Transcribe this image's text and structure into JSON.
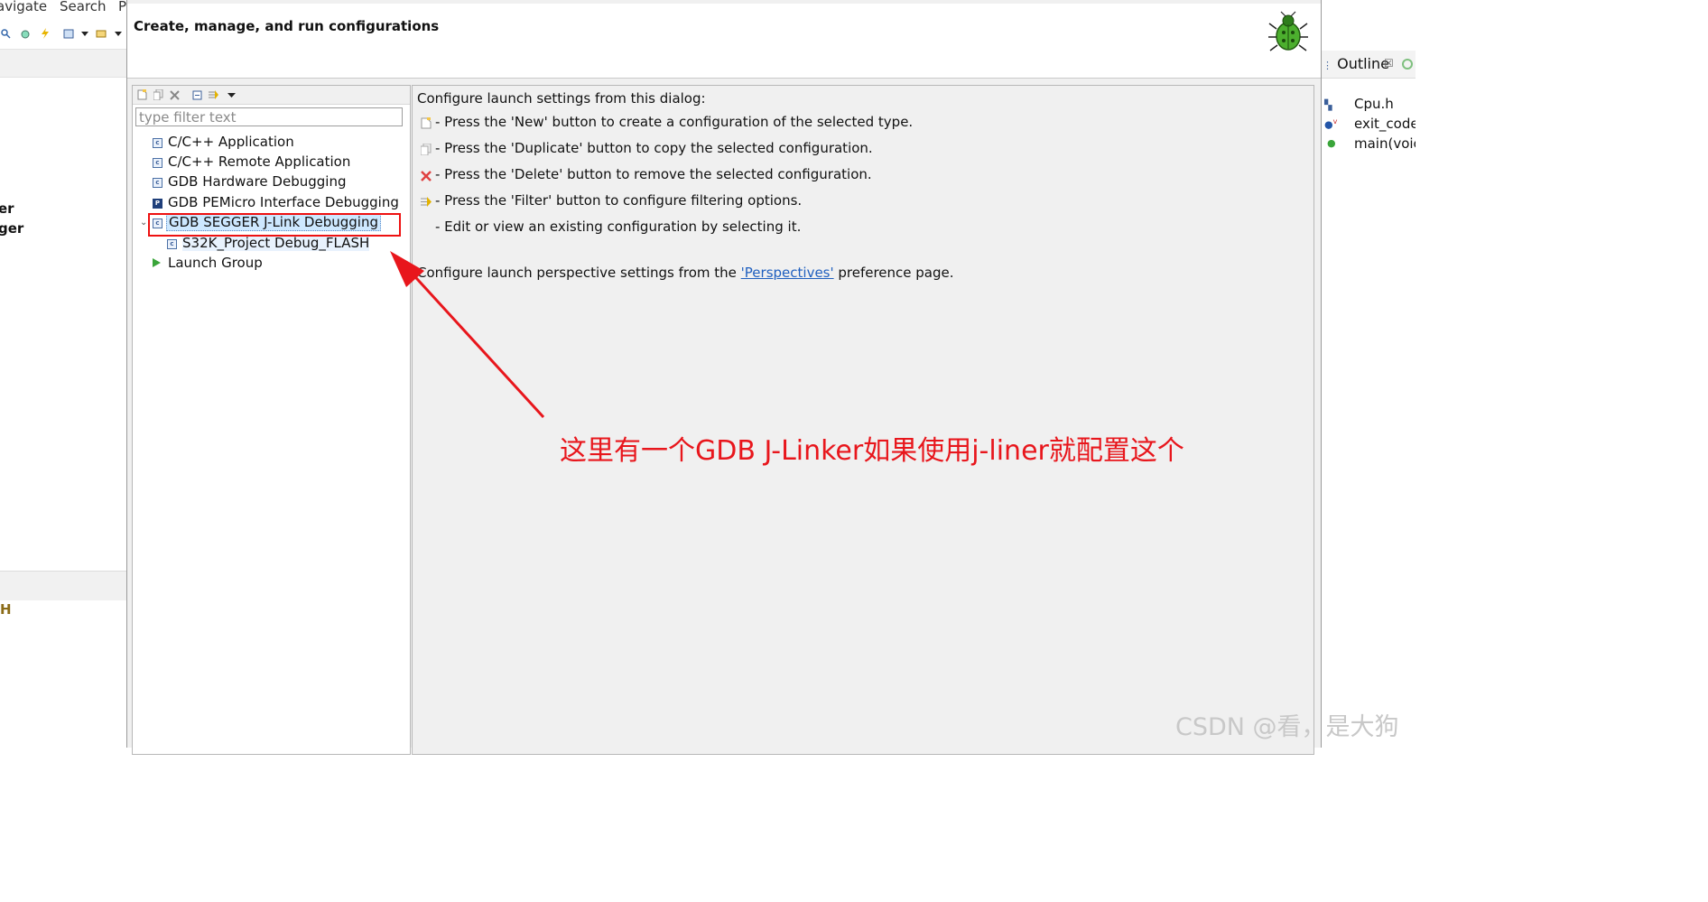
{
  "ide": {
    "menu": [
      "avigate",
      "Search",
      "P"
    ],
    "left_labels": [
      "er",
      "ger"
    ],
    "left_bottom_label": "H",
    "outline": {
      "tab_label": "Outline",
      "close_glyph": "☒",
      "items": [
        {
          "label": "Cpu.h",
          "icon": "header-include-icon"
        },
        {
          "label": "exit_code",
          "icon": "variable-icon"
        },
        {
          "label": "main(voic",
          "icon": "function-icon"
        }
      ]
    }
  },
  "dialog": {
    "title": "Create, manage, and run configurations",
    "header_icon": "bug-icon",
    "filter_placeholder": "type filter text",
    "tree": [
      {
        "label": "C/C++ Application",
        "icon": "c-config-icon"
      },
      {
        "label": "C/C++ Remote Application",
        "icon": "c-config-icon"
      },
      {
        "label": "GDB Hardware Debugging",
        "icon": "c-config-icon"
      },
      {
        "label": "GDB PEMicro Interface Debugging",
        "icon": "pemicro-icon"
      },
      {
        "label": "GDB SEGGER J-Link Debugging",
        "icon": "c-config-icon",
        "expanded": true,
        "selected": true
      },
      {
        "label": "S32K_Project Debug_FLASH",
        "icon": "c-config-icon",
        "child": true
      },
      {
        "label": "Launch Group",
        "icon": "launch-group-icon"
      }
    ],
    "help": {
      "intro": "Configure launch settings from this dialog:",
      "lines": [
        {
          "icon": "new-icon",
          "text": "- Press the 'New' button to create a configuration of the selected type."
        },
        {
          "icon": "duplicate-icon",
          "text": "- Press the 'Duplicate' button to copy the selected configuration."
        },
        {
          "icon": "delete-icon",
          "text": "- Press the 'Delete' button to remove the selected configuration."
        },
        {
          "icon": "filter-icon",
          "text": "- Press the 'Filter' button to configure filtering options."
        },
        {
          "icon": "",
          "text": "- Edit or view an existing configuration by selecting it."
        }
      ],
      "perspective_prefix": "Configure launch perspective settings from the ",
      "perspective_link": "'Perspectives'",
      "perspective_suffix": " preference page."
    }
  },
  "annotation": {
    "text": "这里有一个GDB J-Linker如果使用j-liner就配置这个",
    "color": "#e8161c"
  },
  "watermark": "CSDN @看，是大狗"
}
